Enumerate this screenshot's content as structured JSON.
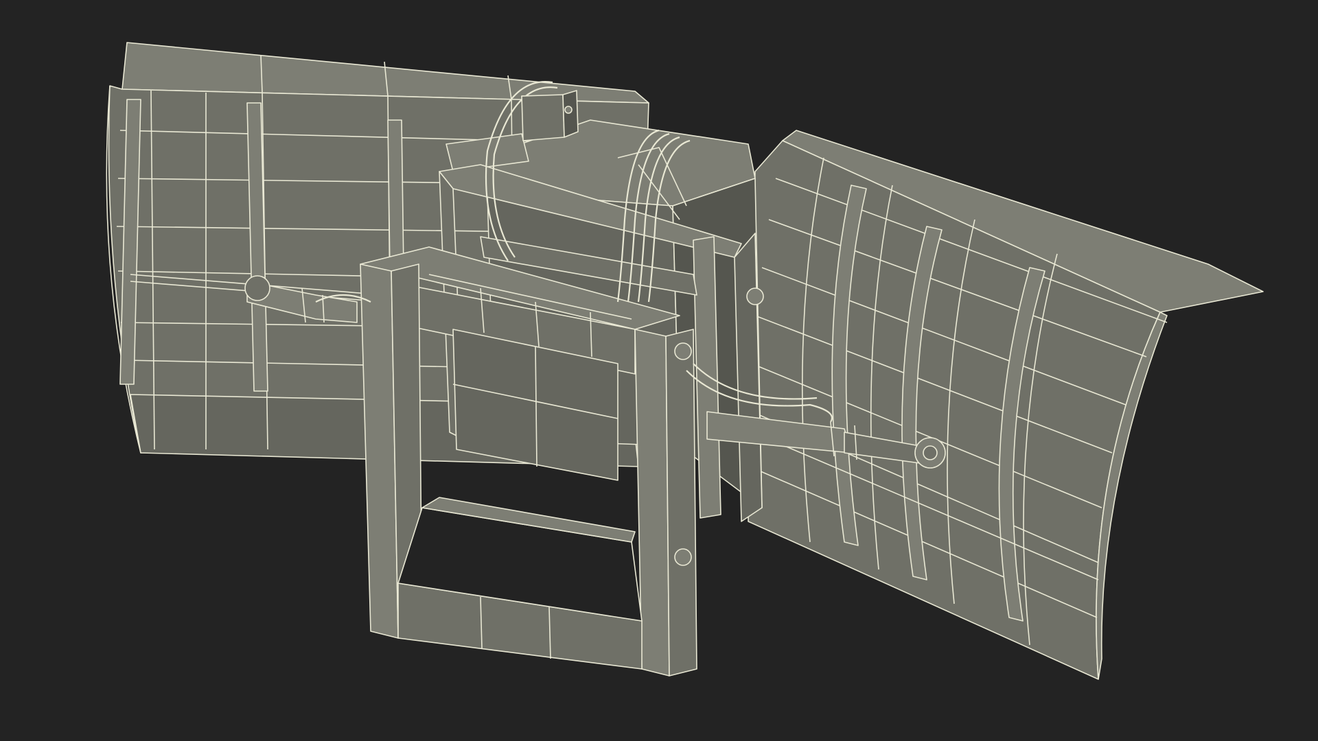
{
  "colors": {
    "background": "#232323",
    "surface": "#6f7067",
    "surface_light": "#7d7e74",
    "surface_dark": "#55564f",
    "wire": "#e9e8d4",
    "shadow": "#1a1a1a"
  },
  "icons": []
}
